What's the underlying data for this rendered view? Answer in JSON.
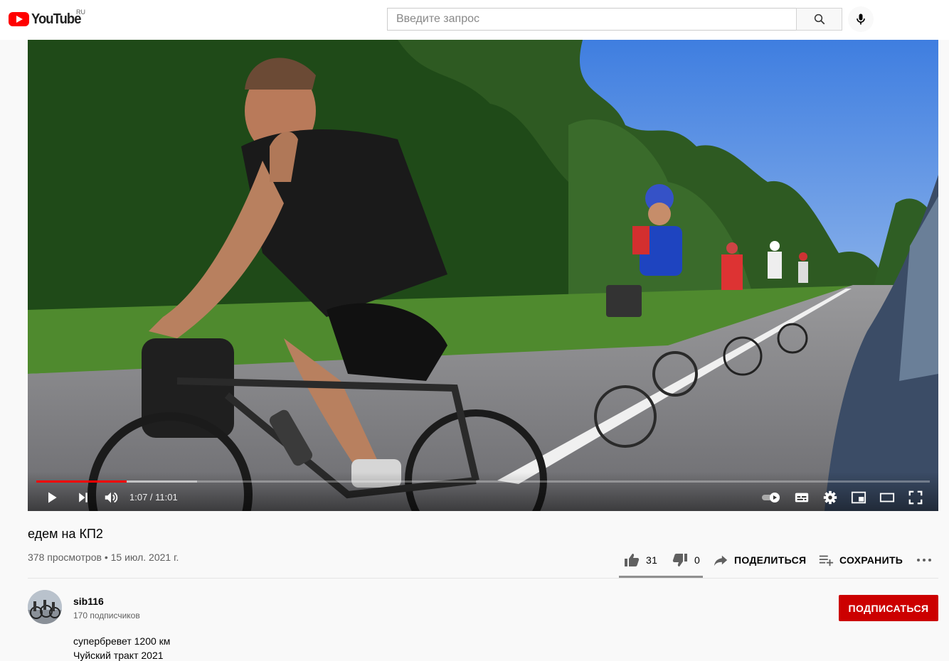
{
  "header": {
    "logo_text": "YouTube",
    "region": "RU",
    "search_placeholder": "Введите запрос",
    "icons": {
      "logo": "youtube-logo-icon",
      "search": "search-icon",
      "mic": "microphone-icon"
    }
  },
  "player": {
    "current_time": "1:07",
    "duration": "11:01",
    "time_text": "1:07 / 11:01",
    "progress_fraction": 0.101,
    "buffered_fraction": 0.18,
    "colors": {
      "progress": "#ff0000"
    },
    "controls": [
      "play-icon",
      "next-icon",
      "volume-icon",
      "autoplay-toggle",
      "subtitles-icon",
      "settings-icon",
      "miniplayer-icon",
      "theater-mode-icon",
      "fullscreen-icon"
    ]
  },
  "video": {
    "title": "едем на КП2",
    "views": "378 просмотров",
    "separator": "•",
    "date": "15 июл. 2021 г.",
    "likes": "31",
    "dislikes": "0",
    "share_label": "ПОДЕЛИТЬСЯ",
    "save_label": "СОХРАНИТЬ",
    "like_ratio": 1.0
  },
  "channel": {
    "name": "sib116",
    "subscribers": "170 подписчиков",
    "subscribe_label": "ПОДПИСАТЬСЯ",
    "colors": {
      "subscribe": "#cc0000"
    }
  },
  "description": {
    "lines": [
      "супербревет 1200 км",
      "Чуйский тракт 2021"
    ]
  }
}
